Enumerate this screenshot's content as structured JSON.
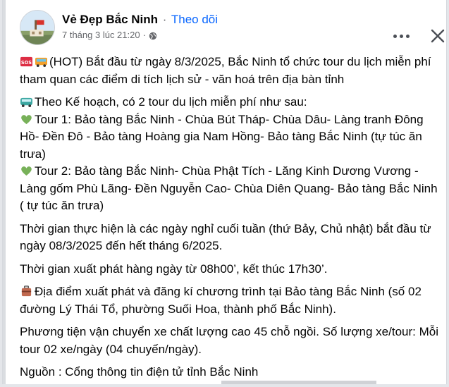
{
  "post": {
    "page_name": "Vẻ Đẹp Bắc Ninh",
    "separator": "·",
    "follow_label": "Theo dõi",
    "timestamp": "7 tháng 3 lúc 21:20",
    "meta_separator": "·",
    "privacy_icon": "globe-icon",
    "more_icon": "more-options-icon",
    "close_icon": "close-icon"
  },
  "content": {
    "p1": "(HOT) Bắt đầu từ ngày 8/3/2025, Bắc Ninh tổ chức tour du lịch miễn phí tham quan các điểm di tích lịch sử - văn hoá trên địa bàn tỉnh",
    "p2": "Theo Kế hoạch, có 2 tour du lịch miễn phí như sau:",
    "tour1": "Tour 1: Bảo tàng Bắc Ninh - Chùa Bút Tháp- Chùa Dâu- Làng tranh Đông Hồ- Đền Đô - Bảo tàng Hoàng gia Nam Hồng- Bảo tàng Bắc Ninh   (tự túc ăn trưa)",
    "tour2": "Tour 2: Bảo tàng Bắc Ninh- Chùa Phật Tích - Lăng Kinh Dương Vương - Làng gốm Phù Lãng- Đền Nguyễn Cao- Chùa Diên Quang- Bảo tàng Bắc Ninh ( tự túc ăn trưa)",
    "p3": "Thời gian thực hiện là các ngày nghỉ cuối tuần (thứ Bảy, Chủ nhật) bắt đầu từ ngày 08/3/2025 đến hết tháng 6/2025.",
    "p4": "Thời gian xuất phát hàng ngày từ 08h00’, kết thúc 17h30’.",
    "p5": "Địa điểm xuất phát và đăng kí chương trình tại Bảo tàng Bắc Ninh (số 02 đường Lý Thái Tổ, phường Suối Hoa, thành phố Bắc Ninh).",
    "p6": "Phương tiện vận chuyển xe chất lượng cao 45 chỗ ngồi. Số lượng xe/tour: Mỗi tour 02 xe/ngày (04 chuyến/ngày).",
    "p7": "Nguồn : Cổng thông tin điện tử tỉnh Bắc Ninh",
    "emojis": [
      "sos-emoji",
      "bus-emoji",
      "minibus-emoji",
      "green-heart-emoji",
      "green-heart-emoji",
      "luggage-emoji"
    ]
  },
  "colors": {
    "link_blue": "#0866ff",
    "meta_gray": "#65676b",
    "text": "#050505",
    "heart_green": "#78b159",
    "sos_red": "#dd2e44"
  }
}
